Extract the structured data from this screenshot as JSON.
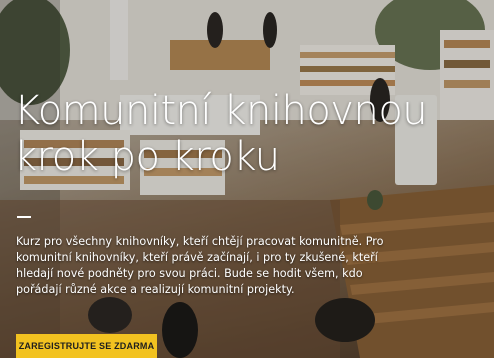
{
  "hero": {
    "title_line1": "Komunitní knihovnou",
    "title_line2": "krok po kroku",
    "description": "Kurz pro všechny knihovníky, kteří chtějí pracovat komunitně. Pro komunitní knihovníky, kteří právě začínají, i pro ty zkušené, kteří hledají nové podněty pro svou práci. Bude se hodit všem, kdo pořádají různé akce a realizují komunitní projekty.",
    "cta_label": "ZAREGISTRUJTE SE ZDARMA"
  },
  "colors": {
    "accent": "#f2c220",
    "text": "#ffffff"
  }
}
